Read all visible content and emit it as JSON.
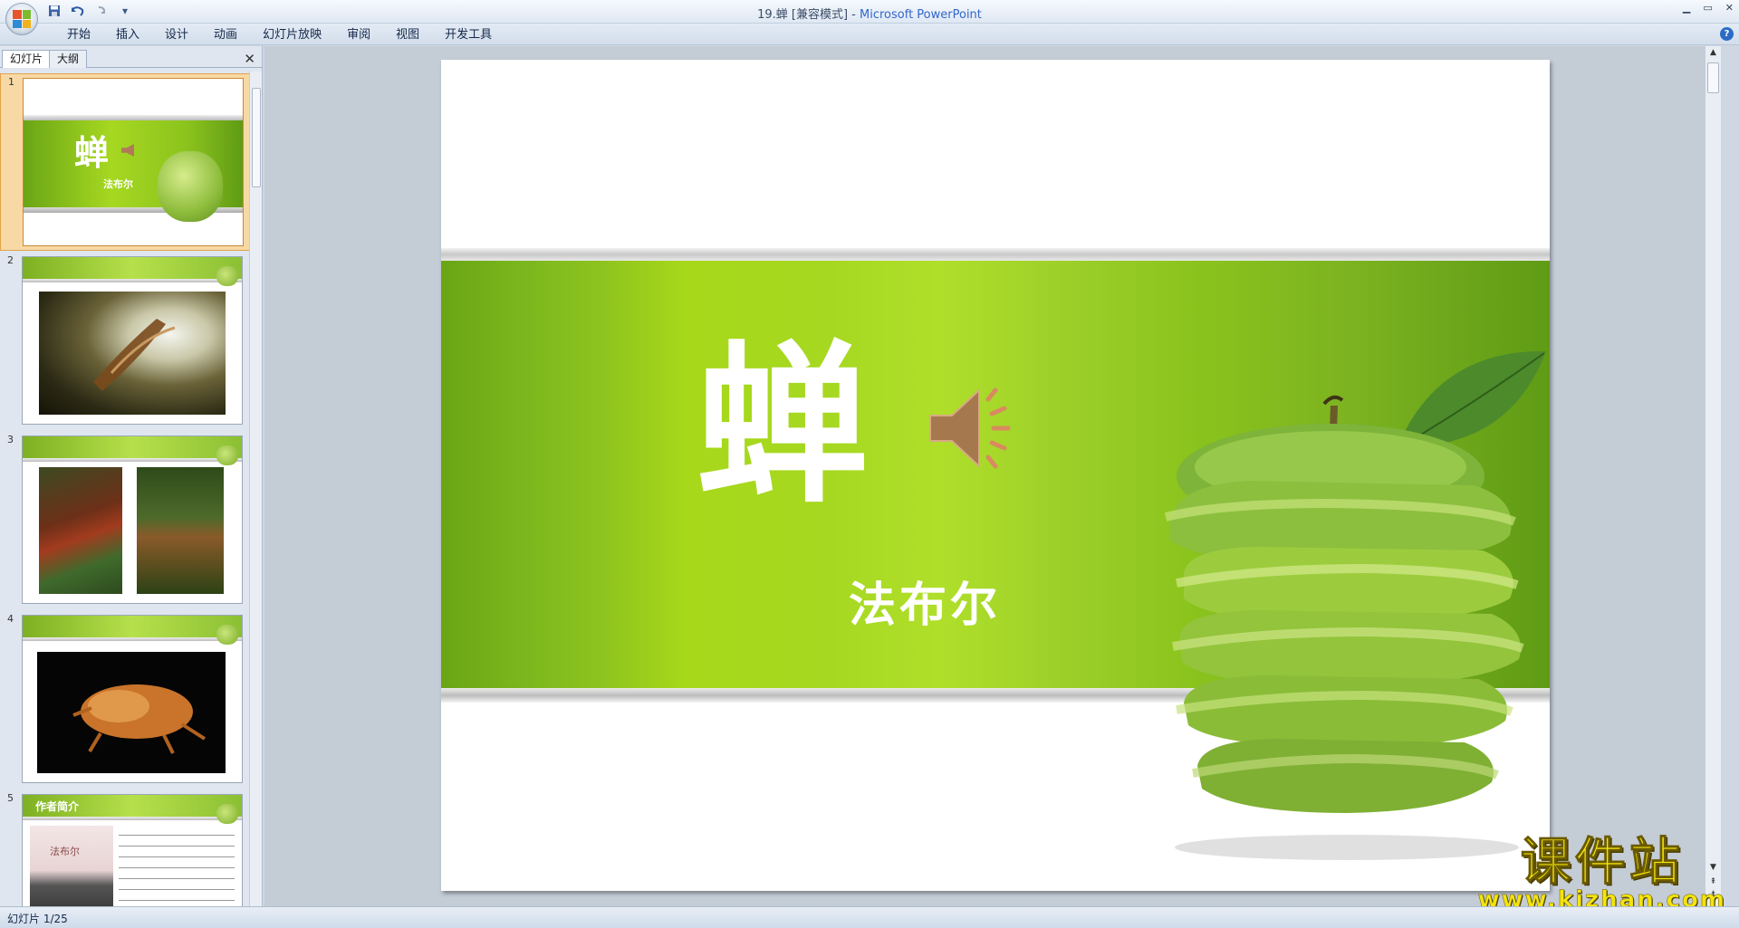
{
  "window": {
    "document_name": "19.蝉 [兼容模式]",
    "separator": " - ",
    "app_name": "Microsoft PowerPoint"
  },
  "ribbon": {
    "tabs": [
      "开始",
      "插入",
      "设计",
      "动画",
      "幻灯片放映",
      "审阅",
      "视图",
      "开发工具"
    ]
  },
  "left_pane": {
    "tabs": [
      "幻灯片",
      "大纲"
    ],
    "thumbnails": [
      {
        "number": "1",
        "title": "蝉",
        "subtitle": "法布尔"
      },
      {
        "number": "2"
      },
      {
        "number": "3"
      },
      {
        "number": "4"
      },
      {
        "number": "5",
        "heading": "作者简介",
        "portrait_label": "法布尔"
      }
    ]
  },
  "slide": {
    "title": "蝉",
    "author": "法布尔"
  },
  "status": {
    "slide_position": "幻灯片 1/25"
  },
  "watermark": {
    "line1": "课件站",
    "line2": "www.kjzhan.com"
  },
  "colors": {
    "band_green": "#8cc21e",
    "apple_green": "#9ccc3e",
    "selection": "#f8d9a6"
  }
}
